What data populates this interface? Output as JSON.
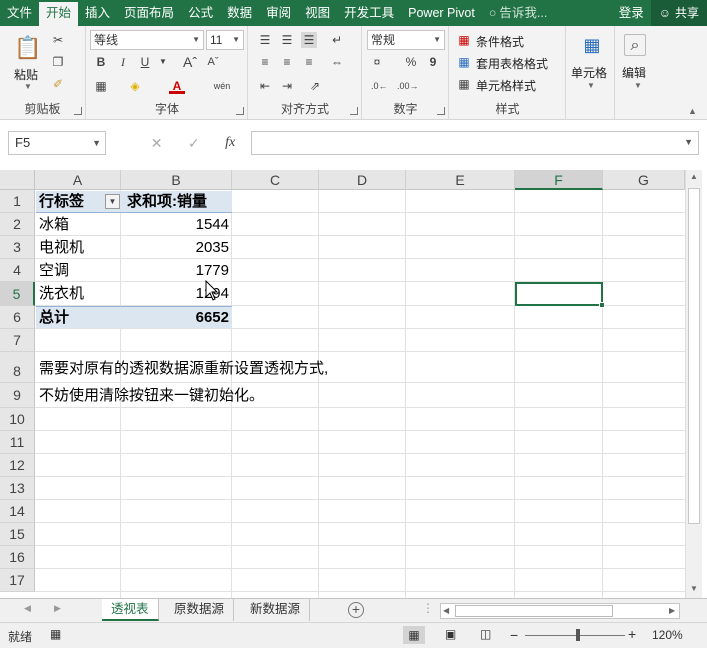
{
  "ribbon_tabs": [
    "文件",
    "开始",
    "插入",
    "页面布局",
    "公式",
    "数据",
    "审阅",
    "视图",
    "开发工具",
    "Power Pivot"
  ],
  "active_tab": "开始",
  "tell_me": "告诉我...",
  "login": "登录",
  "share": "共享",
  "ribbon": {
    "clipboard": {
      "label": "剪贴板",
      "paste": "粘贴"
    },
    "font": {
      "label": "字体",
      "font_name": "等线",
      "font_size": "11",
      "bold": "B",
      "italic": "I",
      "underline": "U",
      "font_color_letter": "A",
      "phonetic": "wén"
    },
    "alignment": {
      "label": "对齐方式"
    },
    "number": {
      "label": "数字",
      "format": "常规",
      "percent": "%",
      "comma": "9"
    },
    "styles": {
      "label": "样式",
      "conditional": "条件格式",
      "table": "套用表格格式",
      "cell_style": "单元格样式"
    },
    "cells": {
      "label": "单元格"
    },
    "editing": {
      "label": "编辑"
    }
  },
  "name_box": "F5",
  "fx": "fx",
  "columns": [
    "A",
    "B",
    "C",
    "D",
    "E",
    "F",
    "G"
  ],
  "rows": [
    "1",
    "2",
    "3",
    "4",
    "5",
    "6",
    "7",
    "8",
    "9",
    "10",
    "11",
    "12",
    "13",
    "14",
    "15",
    "16",
    "17"
  ],
  "pivot": {
    "row_label": "行标签",
    "value_label": "求和项:销量",
    "items": [
      {
        "name": "冰箱",
        "value": "1544"
      },
      {
        "name": "电视机",
        "value": "2035"
      },
      {
        "name": "空调",
        "value": "1779"
      },
      {
        "name": "洗衣机",
        "value": "1294"
      }
    ],
    "total_label": "总计",
    "total_value": "6652"
  },
  "note_line1": "需要对原有的透视数据源重新设置透视方式,",
  "note_line2": "不妨使用清除按钮来一键初始化。",
  "sheets": [
    "透视表",
    "原数据源",
    "新数据源"
  ],
  "active_sheet": "透视表",
  "status": "就绪",
  "zoom": "120%",
  "zoom_minus": "−",
  "zoom_plus": "+"
}
